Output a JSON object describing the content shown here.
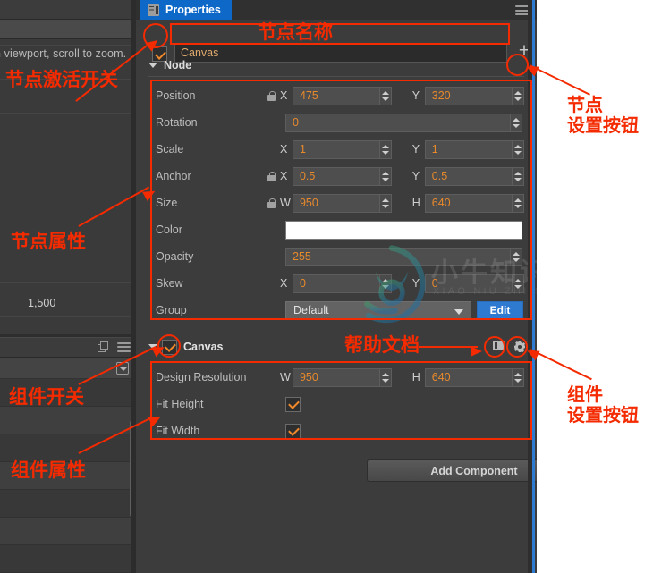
{
  "app": {
    "tab_label": "Properties",
    "tab_icon": "properties-list-icon",
    "menu_icon": "hamburger-menu-icon"
  },
  "left_panel": {
    "viewport_hint": "n viewport, scroll to zoom.",
    "grid_number": "1,500",
    "copy_icon": "duplicate-icon",
    "menu_icon": "hamburger-menu-icon"
  },
  "node": {
    "enabled": true,
    "name_value": "Canvas",
    "add_label": "+",
    "section_label": "Node",
    "settings_icon": "gear-icon",
    "rows": [
      {
        "label": "Position",
        "locked": true,
        "type": "xy",
        "x_axis": "X",
        "x_value": "475",
        "y_axis": "Y",
        "y_value": "320"
      },
      {
        "label": "Rotation",
        "locked": false,
        "type": "single",
        "value": "0"
      },
      {
        "label": "Scale",
        "locked": false,
        "type": "xy",
        "x_axis": "X",
        "x_value": "1",
        "y_axis": "Y",
        "y_value": "1"
      },
      {
        "label": "Anchor",
        "locked": true,
        "type": "xy",
        "x_axis": "X",
        "x_value": "0.5",
        "y_axis": "Y",
        "y_value": "0.5"
      },
      {
        "label": "Size",
        "locked": true,
        "type": "xy",
        "x_axis": "W",
        "x_value": "950",
        "y_axis": "H",
        "y_value": "640"
      },
      {
        "label": "Color",
        "locked": false,
        "type": "color",
        "value": "#ffffff"
      },
      {
        "label": "Opacity",
        "locked": false,
        "type": "single",
        "value": "255"
      },
      {
        "label": "Skew",
        "locked": false,
        "type": "xy",
        "x_axis": "X",
        "x_value": "0",
        "y_axis": "Y",
        "y_value": "0"
      },
      {
        "label": "Group",
        "locked": false,
        "type": "select",
        "value": "Default",
        "button_label": "Edit"
      }
    ]
  },
  "component": {
    "enabled": true,
    "title": "Canvas",
    "help_icon": "book-help-icon",
    "settings_icon": "gear-icon",
    "rows": [
      {
        "label": "Design Resolution",
        "type": "xy",
        "x_axis": "W",
        "x_value": "950",
        "y_axis": "H",
        "y_value": "640"
      },
      {
        "label": "Fit Height",
        "type": "checkbox",
        "checked": true
      },
      {
        "label": "Fit Width",
        "type": "checkbox",
        "checked": true
      }
    ]
  },
  "add_component": {
    "label": "Add Component"
  },
  "watermark": {
    "text": "小牛知识库",
    "subtext": "XIAO NIU ZHI SHI KU"
  },
  "annotations": [
    {
      "id": "node-active-switch",
      "text": "节点激活开关"
    },
    {
      "id": "node-name",
      "text": "节点名称"
    },
    {
      "id": "node-settings-button",
      "text": "节点\n设置按钮"
    },
    {
      "id": "node-properties",
      "text": "节点属性"
    },
    {
      "id": "component-switch",
      "text": "组件开关"
    },
    {
      "id": "help-document",
      "text": "帮助文档"
    },
    {
      "id": "component-settings",
      "text": "组件\n设置按钮"
    },
    {
      "id": "component-properties",
      "text": "组件属性"
    }
  ],
  "colors": {
    "annotation": "#f42a00",
    "accent_blue": "#0d68c8",
    "value_orange": "#e8892b",
    "panel_bg": "#3c3c3c"
  }
}
